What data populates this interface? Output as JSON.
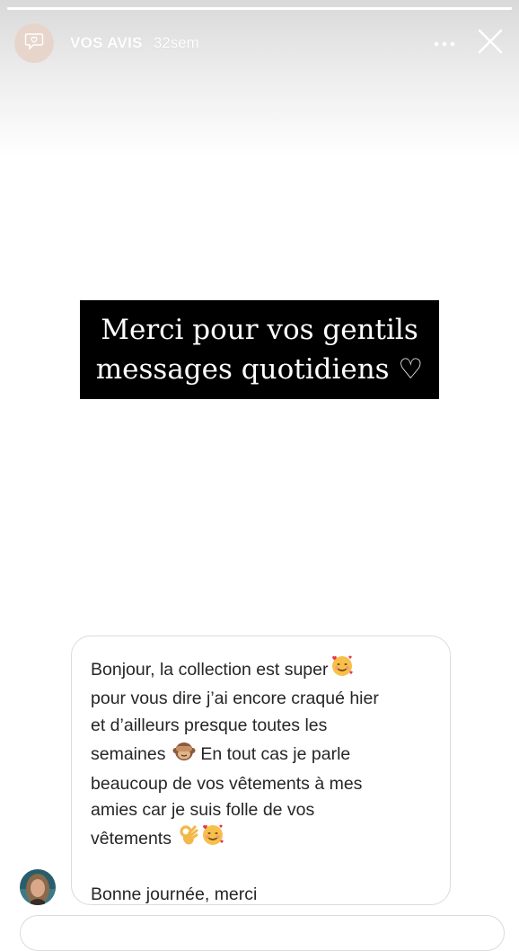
{
  "story": {
    "title": "VOS AVIS",
    "age": "32sem",
    "progress": {
      "total_segments": 1,
      "completed": 1
    }
  },
  "header_icons": {
    "avatar": "chat-heart-icon",
    "more": "more-horizontal-icon",
    "close": "close-icon"
  },
  "headline": {
    "line1": "Merci pour vos gentils",
    "line2": "messages quotidiens ♡"
  },
  "reply": {
    "lines": [
      "Bonjour, la collection est super",
      "pour vous dire j’ai encore craqué hier",
      "et d’ailleurs presque toutes les",
      "semaines",
      "En tout cas je parle",
      "beaucoup de vos vêtements à mes",
      "amies car je suis folle de vos",
      "vêtements",
      "Bonne journée, merci"
    ],
    "emojis": {
      "line1": "smiling-face-with-hearts",
      "line4": "see-no-evil-monkey",
      "line8": [
        "ok-hand",
        "smiling-face-with-hearts"
      ]
    }
  },
  "colors": {
    "headline_bg": "#000000",
    "headline_text": "#ffffff",
    "bubble_border": "#dbdbdb",
    "text": "#262626",
    "avatar_bg": "#e7d5cc"
  }
}
